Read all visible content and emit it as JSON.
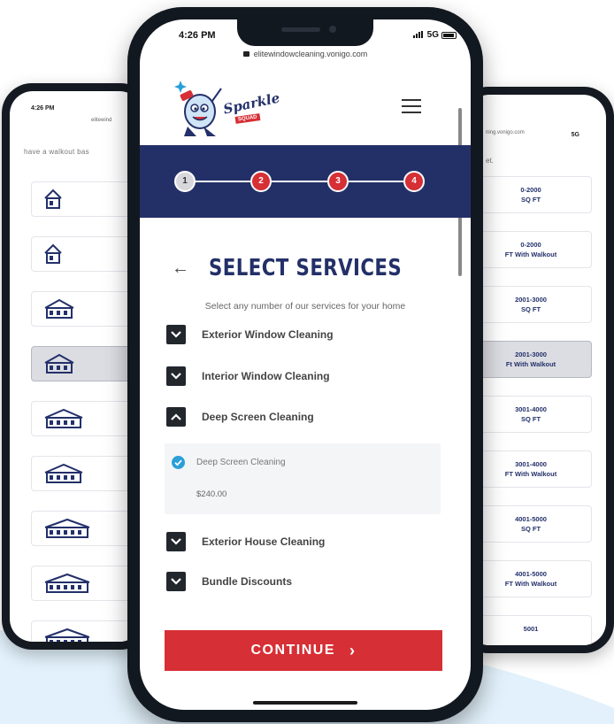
{
  "colors": {
    "navy": "#233068",
    "red": "#d62f35",
    "check_blue": "#2a9fd8",
    "bezel": "#121820",
    "background_swoosh": "#e2f1fb"
  },
  "left_phone": {
    "time": "4:26 PM",
    "url": "elitewind",
    "caption": "have a walkout bas",
    "house_icons": [
      "house-small-icon",
      "house-small-icon",
      "house-medium-icon",
      "house-medium-icon",
      "house-large-icon",
      "house-large-icon",
      "house-xlarge-icon",
      "house-xlarge-icon",
      "house-xlarge-icon"
    ]
  },
  "right_phone": {
    "url": "ning.vonigo.com",
    "caption": "et.",
    "status": "5G",
    "cards": [
      {
        "line1": "0-2000",
        "line2": "SQ FT"
      },
      {
        "line1": "0-2000",
        "line2": "FT With Walkout"
      },
      {
        "line1": "2001-3000",
        "line2": "SQ FT"
      },
      {
        "line1": "2001-3000",
        "line2": "Ft With Walkout"
      },
      {
        "line1": "3001-4000",
        "line2": "SQ FT"
      },
      {
        "line1": "3001-4000",
        "line2": "FT With Walkout"
      },
      {
        "line1": "4001-5000",
        "line2": "SQ FT"
      },
      {
        "line1": "4001-5000",
        "line2": "FT With Walkout"
      },
      {
        "line1": "5001",
        "line2": ""
      }
    ],
    "selected_index": 3
  },
  "center_phone": {
    "time": "4:26 PM",
    "network": "5G",
    "url": "elitewindowcleaning.vonigo.com",
    "logo_text": "Sparkle",
    "logo_subtext": "SQUAD",
    "steps": [
      "1",
      "2",
      "3",
      "4"
    ],
    "active_step": 1,
    "title": "SELECT SERVICES",
    "subtitle": "Select any number of our services for your home",
    "services": [
      {
        "label": "Exterior Window Cleaning",
        "expanded": false
      },
      {
        "label": "Interior Window Cleaning",
        "expanded": false
      },
      {
        "label": "Deep Screen Cleaning",
        "expanded": true
      },
      {
        "label": "Exterior House Cleaning",
        "expanded": false
      },
      {
        "label": "Bundle Discounts",
        "expanded": false
      }
    ],
    "expanded_option": {
      "name": "Deep Screen Cleaning",
      "price": "$240.00",
      "checked": true
    },
    "continue_label": "CONTINUE",
    "continue_icon": "chevron-right-icon"
  }
}
